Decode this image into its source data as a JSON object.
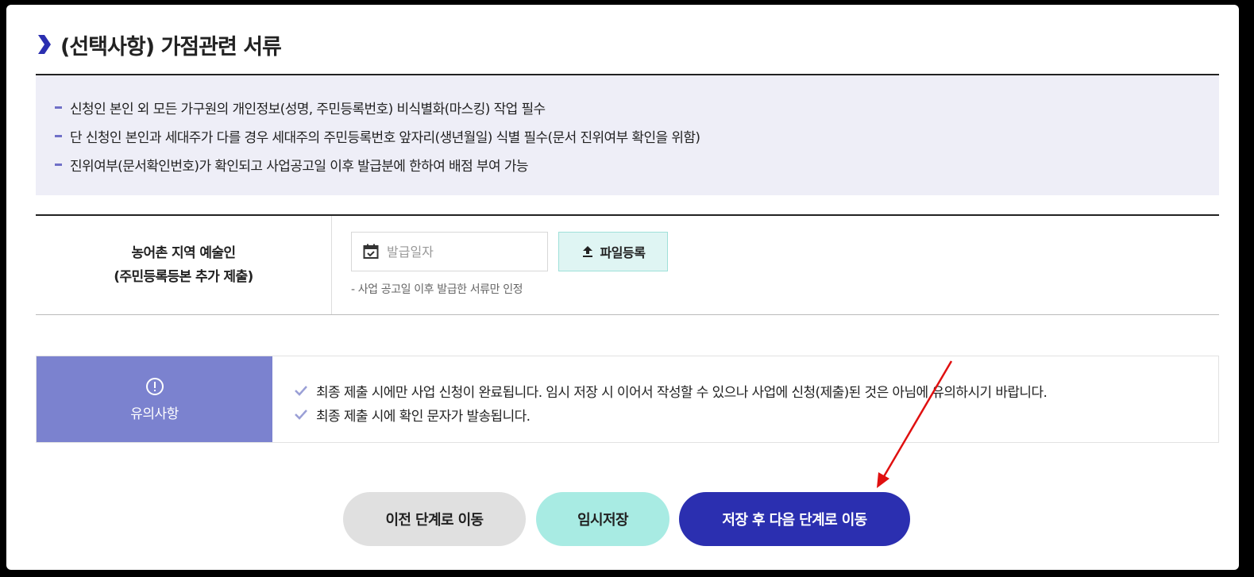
{
  "section": {
    "title": "(선택사항) 가점관련 서류"
  },
  "notice": {
    "items": [
      "신청인 본인 외 모든 가구원의 개인정보(성명, 주민등록번호) 비식별화(마스킹) 작업 필수",
      "단 신청인 본인과 세대주가 다를 경우 세대주의 주민등록번호 앞자리(생년월일) 식별 필수(문서 진위여부 확인을 위함)",
      "진위여부(문서확인번호)가 확인되고 사업공고일 이후 발급분에 한하여 배점 부여 가능"
    ]
  },
  "form": {
    "label_line1": "농어촌 지역 예술인",
    "label_line2": "(주민등록등본 추가 제출)",
    "date_placeholder": "발급일자",
    "upload_label": "파일등록",
    "hint": "- 사업 공고일 이후 발급한 서류만 인정"
  },
  "caution": {
    "title": "유의사항",
    "items": [
      "최종 제출 시에만 사업 신청이 완료됩니다. 임시 저장 시 이어서 작성할 수 있으나 사업에 신청(제출)된 것은 아님에 유의하시기 바랍니다.",
      "최종 제출 시에 확인 문자가 발송됩니다."
    ]
  },
  "buttons": {
    "prev": "이전 단계로 이동",
    "temp_save": "임시저장",
    "save_next": "저장 후 다음 단계로 이동"
  },
  "colors": {
    "accent": "#2b2fb0",
    "caution_bg": "#7b82cf",
    "temp_btn": "#a8ebe3",
    "annotation_arrow": "#e01010"
  }
}
